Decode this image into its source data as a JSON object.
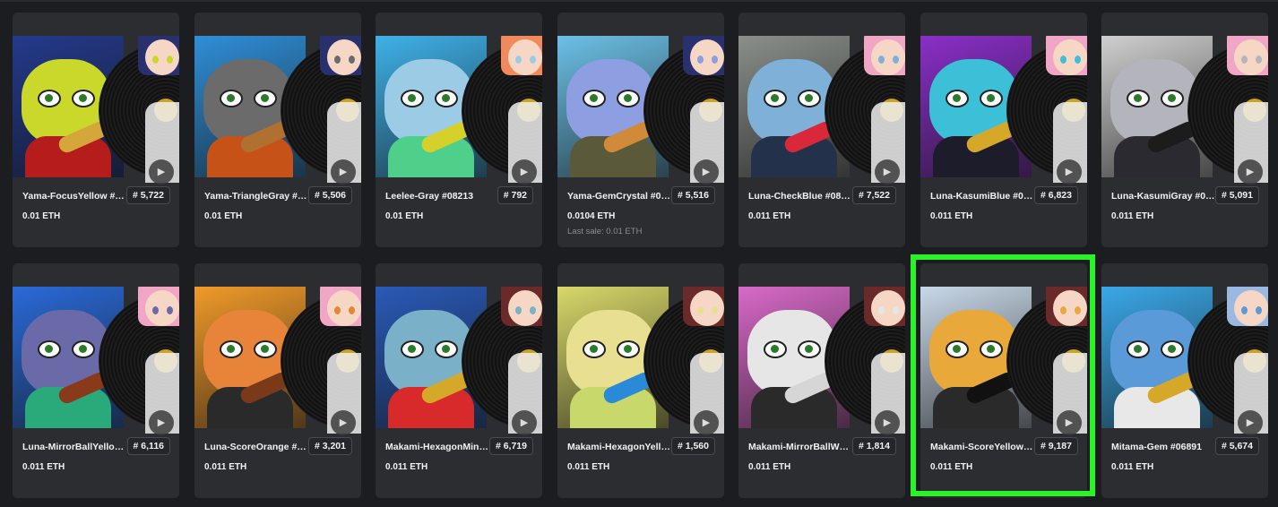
{
  "accent_color": "#2cf22c",
  "play_icon": "play-icon",
  "cards": [
    {
      "name": "Yama-FocusYellow #07...",
      "number": "# 5,722",
      "price": "0.01 ETH",
      "last_sale": "",
      "bg": "#243a8c",
      "face": "#c9d82a",
      "body": "#b51d1d",
      "prop": "#d5a63a",
      "hair": "#28306e",
      "selected": false
    },
    {
      "name": "Yama-TriangleGray #0...",
      "number": "# 5,506",
      "price": "0.01 ETH",
      "last_sale": "",
      "bg": "#2f8fd8",
      "face": "#6b6b6b",
      "body": "#c65218",
      "prop": "#b07030",
      "hair": "#28306e",
      "selected": false
    },
    {
      "name": "Leelee-Gray #08213",
      "number": "# 792",
      "price": "0.01 ETH",
      "last_sale": "",
      "bg": "#3fb1e8",
      "face": "#9ccbe6",
      "body": "#4fd08a",
      "prop": "#d6d12a",
      "hair": "#f08a5d",
      "selected": false
    },
    {
      "name": "Yama-GemCrystal #05...",
      "number": "# 5,516",
      "price": "0.0104 ETH",
      "last_sale": "Last sale: 0.01 ETH",
      "bg": "#6cc0e6",
      "face": "#8d9fe0",
      "body": "#5a5a3a",
      "prop": "#d08a3a",
      "hair": "#28306e",
      "selected": false
    },
    {
      "name": "Luna-CheckBlue #080...",
      "number": "# 7,522",
      "price": "0.011 ETH",
      "last_sale": "",
      "bg": "#8a8f8a",
      "face": "#7fb1d8",
      "body": "#23324a",
      "prop": "#d8283a",
      "hair": "#f2a6c6",
      "selected": false
    },
    {
      "name": "Luna-KasumiBlue #06...",
      "number": "# 6,823",
      "price": "0.011 ETH",
      "last_sale": "",
      "bg": "#8a2fc8",
      "face": "#3cc0d8",
      "body": "#1c1c2a",
      "prop": "#d6a82a",
      "hair": "#f2a6c6",
      "selected": false
    },
    {
      "name": "Luna-KasumiGray #09...",
      "number": "# 5,091",
      "price": "0.011 ETH",
      "last_sale": "",
      "bg": "#cfcfcf",
      "face": "#b4b4bc",
      "body": "#2a2a30",
      "prop": "#1c1c1c",
      "hair": "#f2a6c6",
      "selected": false
    },
    {
      "name": "Luna-MirrorBallYellow ...",
      "number": "# 6,116",
      "price": "0.011 ETH",
      "last_sale": "",
      "bg": "#2a6ad8",
      "face": "#6a6aa8",
      "body": "#2aaa7a",
      "prop": "#8a3a1a",
      "hair": "#f2a6c6",
      "selected": false
    },
    {
      "name": "Luna-ScoreOrange #0...",
      "number": "# 3,201",
      "price": "0.011 ETH",
      "last_sale": "",
      "bg": "#f09a2a",
      "face": "#e8843a",
      "body": "#2a2a2a",
      "prop": "#7a3a1a",
      "hair": "#f2a6c6",
      "selected": false
    },
    {
      "name": "Makami-HexagonMint ...",
      "number": "# 6,719",
      "price": "0.011 ETH",
      "last_sale": "",
      "bg": "#2a5ab8",
      "face": "#7ab0c8",
      "body": "#d82a2a",
      "prop": "#d6a82a",
      "hair": "#6a2a2a",
      "selected": false
    },
    {
      "name": "Makami-HexagonYello...",
      "number": "# 1,560",
      "price": "0.011 ETH",
      "last_sale": "",
      "bg": "#d8d86a",
      "face": "#e8e090",
      "body": "#c8d86a",
      "prop": "#2a8ad8",
      "hair": "#6a2a2a",
      "selected": false
    },
    {
      "name": "Makami-MirrorBallWhit...",
      "number": "# 1,814",
      "price": "0.011 ETH",
      "last_sale": "",
      "bg": "#d86ac8",
      "face": "#e6e6e6",
      "body": "#2a2a2a",
      "prop": "#d6d6d6",
      "hair": "#6a2a2a",
      "selected": false
    },
    {
      "name": "Makami-ScoreYellow #...",
      "number": "# 9,187",
      "price": "0.011 ETH",
      "last_sale": "",
      "bg": "#c8d8e8",
      "face": "#e8a83a",
      "body": "#2a2a2a",
      "prop": "#111111",
      "hair": "#6a2a2a",
      "selected": true
    },
    {
      "name": "Mitama-Gem #06891",
      "number": "# 5,674",
      "price": "0.011 ETH",
      "last_sale": "",
      "bg": "#3aa8e8",
      "face": "#5a9ad8",
      "body": "#e8e8e8",
      "prop": "#d6a82a",
      "hair": "#9ab8e0",
      "selected": false
    }
  ]
}
